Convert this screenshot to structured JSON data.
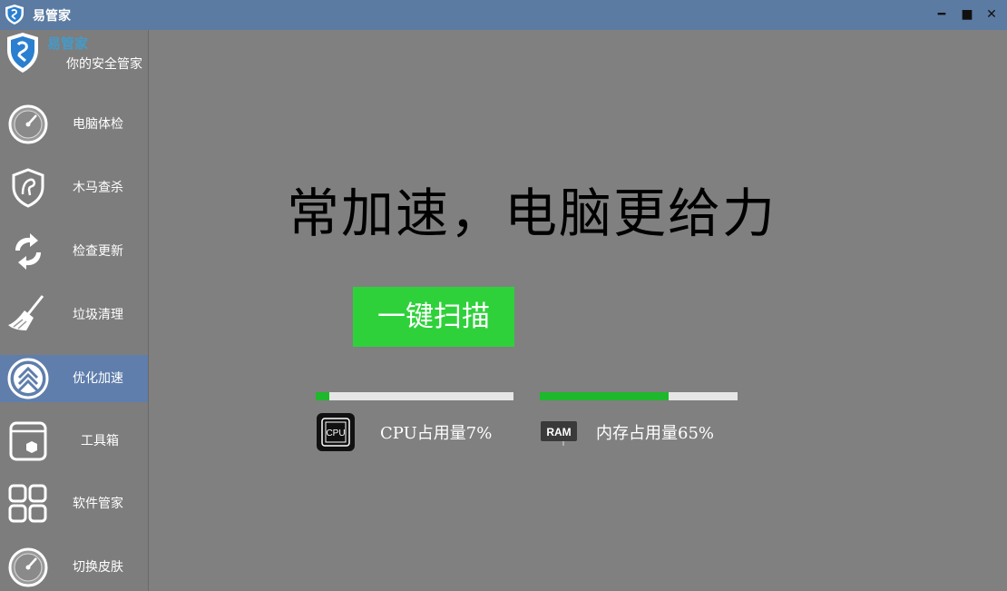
{
  "window": {
    "title": "易管家",
    "minimize_glyph": "━",
    "maximize_glyph": "■",
    "close_glyph": "✕"
  },
  "brand": {
    "name": "易管家",
    "slogan": "你的安全管家",
    "icon": "shield-logo-icon"
  },
  "sidebar": {
    "items": [
      {
        "label": "电脑体检",
        "icon": "gauge-icon",
        "active": false
      },
      {
        "label": "木马查杀",
        "icon": "shield-horse-icon",
        "active": false
      },
      {
        "label": "检查更新",
        "icon": "refresh-icon",
        "active": false
      },
      {
        "label": "垃圾清理",
        "icon": "broom-icon",
        "active": false
      },
      {
        "label": "优化加速",
        "icon": "speed-arrows-icon",
        "active": true
      },
      {
        "label": "工具箱",
        "icon": "toolbox-icon",
        "active": false
      },
      {
        "label": "软件管家",
        "icon": "grid-apps-icon",
        "active": false
      },
      {
        "label": "切换皮肤",
        "icon": "gauge-icon",
        "active": false
      }
    ]
  },
  "main": {
    "headline": "常加速，电脑更给力",
    "scan_button_label": "一键扫描",
    "cpu": {
      "label": "CPU占用量7%",
      "usage_percent": 7,
      "icon": "cpu-chip-icon",
      "icon_text": "CPU"
    },
    "ram": {
      "label": "内存占用量65%",
      "usage_percent": 65,
      "icon": "ram-module-icon",
      "icon_text": "RAM"
    }
  },
  "colors": {
    "titlebar": "#5b7ba3",
    "active_nav": "#5f7eac",
    "scan_button": "#2fd13b",
    "progress_fill": "#1eb82c",
    "progress_track": "#e6e6e6",
    "background": "#808080"
  }
}
